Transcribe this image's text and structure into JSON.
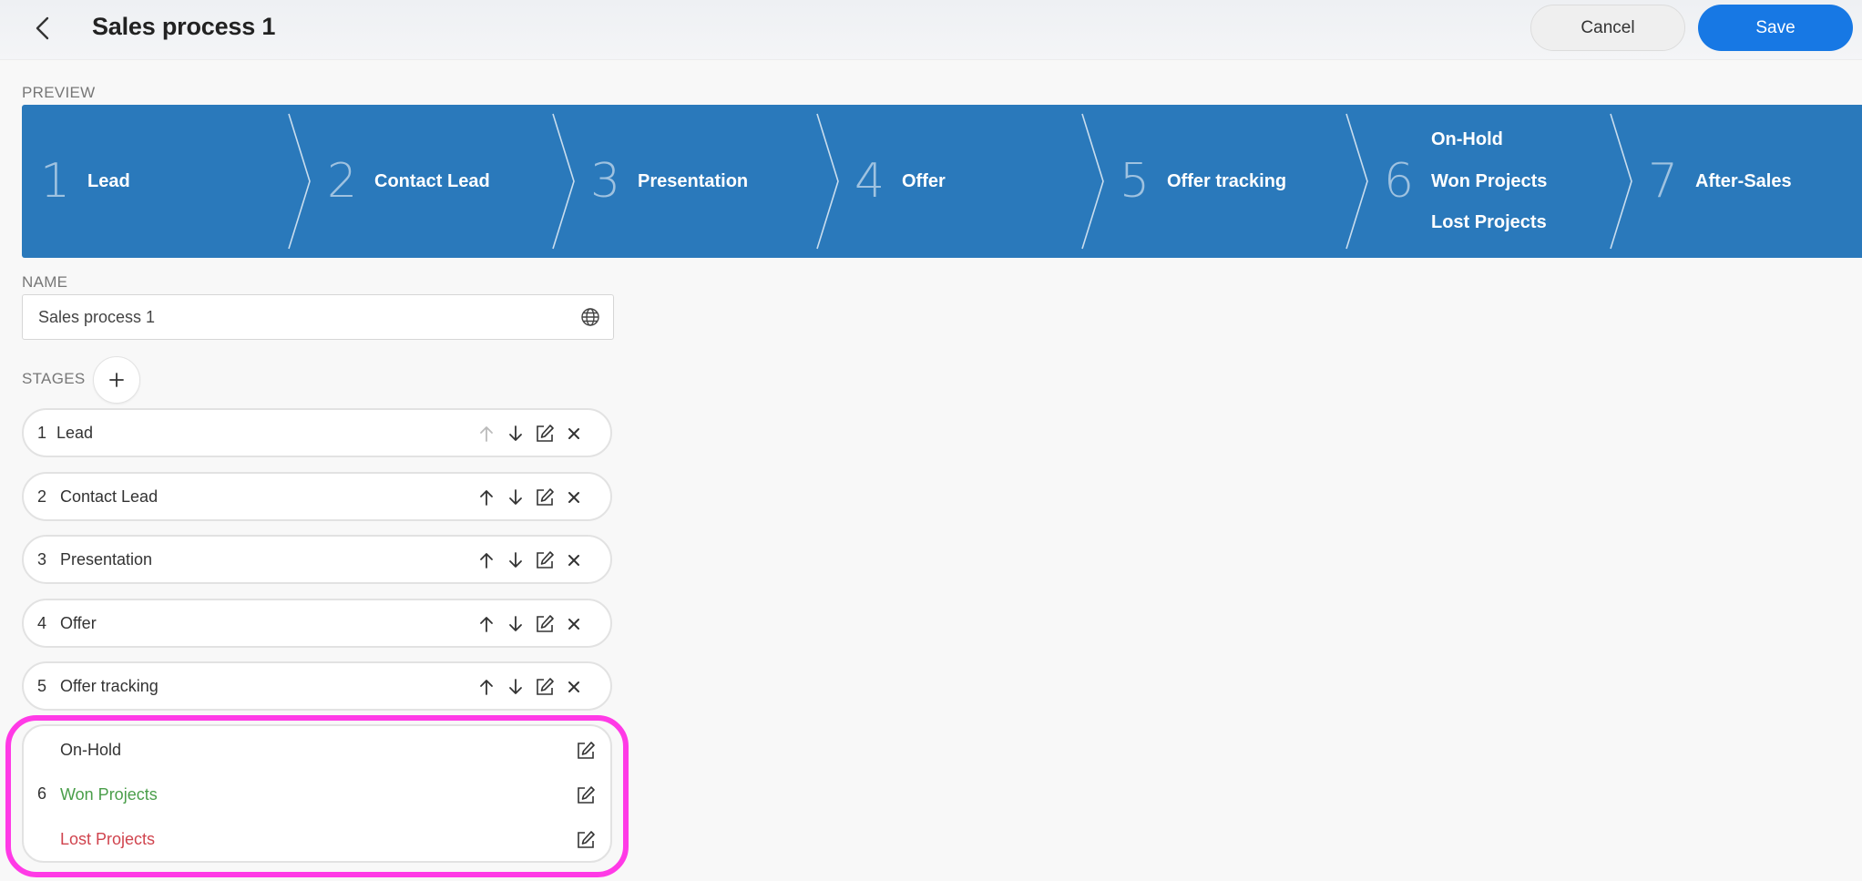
{
  "header": {
    "title": "Sales process 1",
    "cancel_label": "Cancel",
    "save_label": "Save"
  },
  "labels": {
    "preview": "PREVIEW",
    "name": "NAME",
    "stages": "STAGES"
  },
  "preview": {
    "stages": [
      {
        "num": "1",
        "label": "Lead"
      },
      {
        "num": "2",
        "label": "Contact Lead"
      },
      {
        "num": "3",
        "label": "Presentation"
      },
      {
        "num": "4",
        "label": "Offer"
      },
      {
        "num": "5",
        "label": "Offer tracking"
      },
      {
        "num": "6",
        "labels": [
          "On-Hold",
          "Won Projects",
          "Lost Projects"
        ]
      },
      {
        "num": "7",
        "label": "After-Sales"
      }
    ]
  },
  "name_field": {
    "value": "Sales process 1",
    "icon": "globe-icon"
  },
  "stages": [
    {
      "num": "1",
      "name": "Lead"
    },
    {
      "num": "2",
      "name": "Contact Lead"
    },
    {
      "num": "3",
      "name": "Presentation"
    },
    {
      "num": "4",
      "name": "Offer"
    },
    {
      "num": "5",
      "name": "Offer tracking"
    }
  ],
  "group_stage": {
    "num": "6",
    "items": [
      "On-Hold",
      "Won Projects",
      "Lost Projects"
    ]
  },
  "colors": {
    "accent": "#1778e4",
    "preview_band": "#2a79bb",
    "won": "#4a9e4a",
    "lost": "#d0444e",
    "highlight": "#ff3ae6"
  }
}
